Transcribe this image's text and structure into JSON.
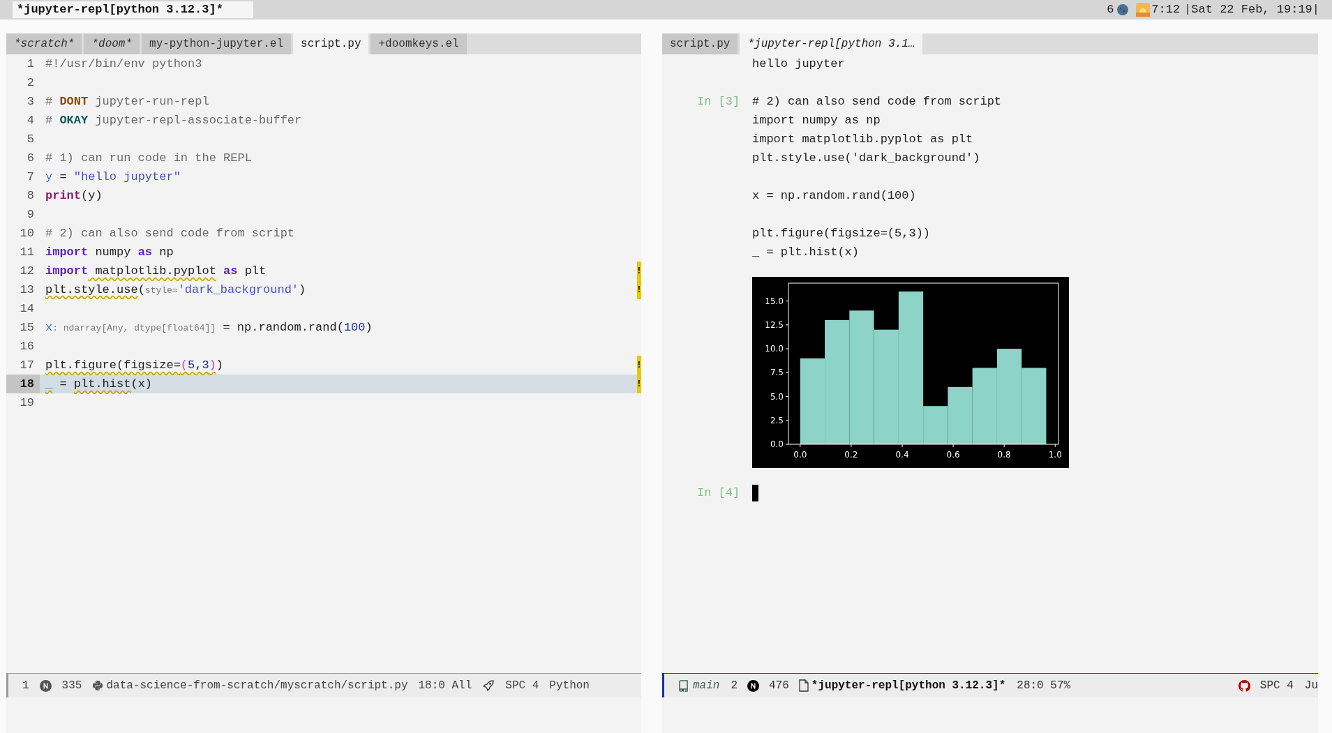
{
  "top_bar": {
    "buffer_title": "*jupyter-repl[python 3.12.3]*",
    "count": "6",
    "sunrise": "7:12",
    "datetime": "|Sat 22 Feb, 19:19|"
  },
  "left_pane": {
    "tabs": [
      {
        "label": "*scratch*",
        "italic": true,
        "selected": false
      },
      {
        "label": "*doom*",
        "italic": true,
        "selected": false
      },
      {
        "label": "my-python-jupyter.el",
        "italic": false,
        "selected": false
      },
      {
        "label": "script.py",
        "italic": false,
        "selected": true
      },
      {
        "label": "+doomkeys.el",
        "italic": false,
        "selected": false
      }
    ],
    "lines": [
      {
        "number": "1",
        "current": false,
        "tokens": [
          {
            "t": "#!/usr/bin/env python3",
            "kind": "comment"
          }
        ]
      },
      {
        "number": "2",
        "current": false
      },
      {
        "number": "3",
        "current": false,
        "tokens": [
          {
            "t": "# ",
            "kind": "comment"
          },
          {
            "t": "DONT",
            "kind": "todo"
          },
          {
            "t": " jupyter-run-repl",
            "kind": "comment"
          }
        ]
      },
      {
        "number": "4",
        "current": false,
        "tokens": [
          {
            "t": "# ",
            "kind": "comment"
          },
          {
            "t": "OKAY",
            "kind": "okay"
          },
          {
            "t": " jupyter-repl-associate-buffer",
            "kind": "comment"
          }
        ]
      },
      {
        "number": "5",
        "current": false
      },
      {
        "number": "6",
        "current": false,
        "tokens": [
          {
            "t": "# 1) can run code in the REPL",
            "kind": "comment"
          }
        ]
      },
      {
        "number": "7",
        "current": false,
        "tokens": [
          {
            "t": "y",
            "kind": "var"
          },
          {
            "t": " = ",
            "kind": "plain"
          },
          {
            "t": "\"hello jupyter\"",
            "kind": "string"
          }
        ]
      },
      {
        "number": "8",
        "current": false,
        "tokens": [
          {
            "t": "print",
            "kind": "builtin"
          },
          {
            "t": "(y)",
            "kind": "plain"
          }
        ]
      },
      {
        "number": "9",
        "current": false
      },
      {
        "number": "10",
        "current": false,
        "tokens": [
          {
            "t": "# 2) can also send code from script",
            "kind": "comment"
          }
        ]
      },
      {
        "number": "11",
        "current": false,
        "tokens": [
          {
            "t": "import",
            "kind": "keyword"
          },
          {
            "t": " numpy ",
            "kind": "plain"
          },
          {
            "t": "as",
            "kind": "keyword"
          },
          {
            "t": " np",
            "kind": "plain"
          }
        ]
      },
      {
        "number": "12",
        "current": false,
        "marker": "!",
        "tokens": [
          {
            "t": "import",
            "kind": "keyword"
          },
          {
            "t": " matplotlib.pyplot",
            "kind": "plain",
            "squiggle": true
          },
          {
            "t": " as",
            "kind": "keyword"
          },
          {
            "t": " plt",
            "kind": "plain"
          }
        ]
      },
      {
        "number": "13",
        "current": false,
        "marker": "!",
        "tokens": [
          {
            "t": "plt.style.use",
            "kind": "plain",
            "squiggle": true
          },
          {
            "t": "(",
            "kind": "plain"
          },
          {
            "t": "style=",
            "kind": "hint"
          },
          {
            "t": "'dark_background'",
            "kind": "string"
          },
          {
            "t": ")",
            "kind": "plain"
          }
        ]
      },
      {
        "number": "14",
        "current": false
      },
      {
        "number": "15",
        "current": false,
        "tokens": [
          {
            "t": "x",
            "kind": "var"
          },
          {
            "t": ": ndarray[Any, dtype[float64]]",
            "kind": "hint"
          },
          {
            "t": " = np.random.rand(",
            "kind": "plain"
          },
          {
            "t": "100",
            "kind": "number"
          },
          {
            "t": ")",
            "kind": "plain"
          }
        ]
      },
      {
        "number": "16",
        "current": false
      },
      {
        "number": "17",
        "current": false,
        "marker": "!",
        "tokens": [
          {
            "t": "plt.figure(figsize=",
            "kind": "plain",
            "squiggle": true
          },
          {
            "t": "(",
            "kind": "paren",
            "squiggle": true
          },
          {
            "t": "5",
            "kind": "number",
            "squiggle": true
          },
          {
            "t": ",",
            "kind": "plain",
            "squiggle": true
          },
          {
            "t": "3",
            "kind": "number",
            "squiggle": true
          },
          {
            "t": ")",
            "kind": "paren",
            "squiggle": true
          },
          {
            "t": ")",
            "kind": "plain"
          }
        ]
      },
      {
        "number": "18",
        "current": true,
        "marker": "!",
        "tokens": [
          {
            "t": "_",
            "kind": "var",
            "squiggle": true
          },
          {
            "t": " = ",
            "kind": "plain"
          },
          {
            "t": "plt.hist",
            "kind": "plain",
            "squiggle": true
          },
          {
            "t": "(x)",
            "kind": "plain"
          }
        ]
      },
      {
        "number": "19",
        "current": false
      }
    ],
    "mode_line": {
      "window_number": "1",
      "size": "335",
      "path": "data-science-from-scratch/myscratch/script.py",
      "position": "18:0 All",
      "indent": "SPC 4",
      "major_mode": "Python"
    }
  },
  "right_pane": {
    "tabs": [
      {
        "label": "script.py",
        "italic": false,
        "selected": false
      },
      {
        "label": "*jupyter-repl[python 3.1…",
        "italic": true,
        "selected": true
      }
    ],
    "cells": [
      {
        "kind": "output",
        "blocks": [
          [
            "hello jupyter"
          ]
        ]
      },
      {
        "kind": "input",
        "prompt": "In [3]",
        "blocks": [
          [
            "# 2) can also send code from script",
            "import numpy as np",
            "import matplotlib.pyplot as plt",
            "plt.style.use('dark_background')"
          ],
          [
            "x = np.random.rand(100)"
          ],
          [
            "plt.figure(figsize=(5,3))",
            "_ = plt.hist(x)"
          ]
        ]
      },
      {
        "kind": "figure",
        "chart_data": {
          "type": "bar",
          "x": [
            0.04825,
            0.14475,
            0.24125,
            0.33775,
            0.43425,
            0.53075,
            0.62725,
            0.72375,
            0.82025,
            0.91675
          ],
          "series": [
            {
              "color": "#8dd3c7",
              "values": [
                9,
                13,
                14,
                12,
                16,
                4,
                6,
                8,
                10,
                8
              ]
            }
          ],
          "xlim": [
            -0.046,
            1.013
          ],
          "ylim": [
            0,
            16.87
          ],
          "xticks": [
            {
              "value": 0,
              "label": "0.0"
            },
            {
              "value": 0.2,
              "label": "0.2"
            },
            {
              "value": 0.4,
              "label": "0.4"
            },
            {
              "value": 0.6,
              "label": "0.6"
            },
            {
              "value": 0.8,
              "label": "0.8"
            },
            {
              "value": 1,
              "label": "1.0"
            }
          ],
          "yticks": [
            {
              "value": 0,
              "label": "0.0"
            },
            {
              "value": 2.5,
              "label": "2.5"
            },
            {
              "value": 5,
              "label": "5.0"
            },
            {
              "value": 7.5,
              "label": "7.5"
            },
            {
              "value": 10,
              "label": "10.0"
            },
            {
              "value": 12.5,
              "label": "12.5"
            },
            {
              "value": 15,
              "label": "15.0"
            }
          ]
        }
      },
      {
        "kind": "prompt",
        "prompt": "In [4]"
      }
    ],
    "mode_line": {
      "branch": "main",
      "window_number": "2",
      "size": "476",
      "buffer": "*jupyter-repl[python 3.12.3]*",
      "position": "28:0 57%",
      "indent": "SPC 4",
      "major_mode": "Ju"
    }
  }
}
